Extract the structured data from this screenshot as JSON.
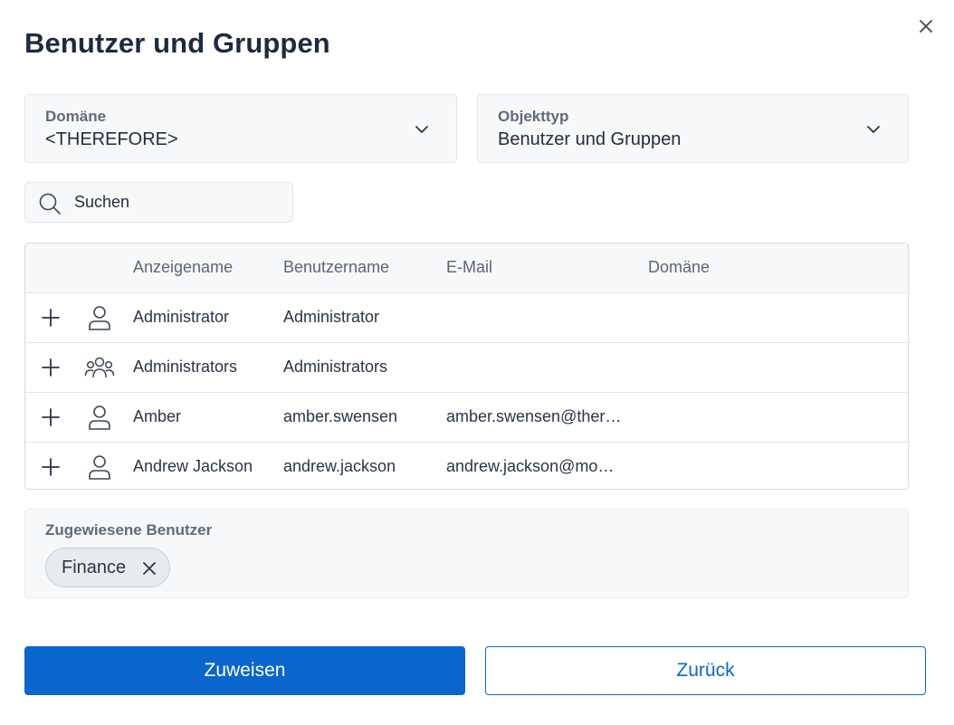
{
  "dialog": {
    "title": "Benutzer und Gruppen"
  },
  "filters": {
    "domain": {
      "label": "Domäne",
      "value": "<THEREFORE>"
    },
    "object_type": {
      "label": "Objekttyp",
      "value": "Benutzer und Gruppen"
    }
  },
  "search": {
    "placeholder": "Suchen",
    "value": ""
  },
  "table": {
    "columns": {
      "display_name": "Anzeigename",
      "username": "Benutzername",
      "email": "E-Mail",
      "domain": "Domäne"
    },
    "rows": [
      {
        "icon": "user-icon",
        "display_name": "Administrator",
        "username": "Administrator",
        "email": "",
        "domain": ""
      },
      {
        "icon": "group-icon",
        "display_name": "Administrators",
        "username": "Administrators",
        "email": "",
        "domain": ""
      },
      {
        "icon": "user-icon",
        "display_name": "Amber",
        "username": "amber.swensen",
        "email": "amber.swensen@ther…",
        "domain": ""
      },
      {
        "icon": "user-icon",
        "display_name": "Andrew Jackson",
        "username": "andrew.jackson",
        "email": "andrew.jackson@mo…",
        "domain": ""
      }
    ]
  },
  "assigned": {
    "label": "Zugewiesene Benutzer",
    "chips": [
      {
        "label": "Finance"
      }
    ]
  },
  "actions": {
    "assign_label": "Zuweisen",
    "back_label": "Zurück"
  },
  "colors": {
    "primary": "#0a66cc",
    "title": "#1e2b3f",
    "panel_bg": "#f7f8f9",
    "border": "#e3e6ea"
  }
}
